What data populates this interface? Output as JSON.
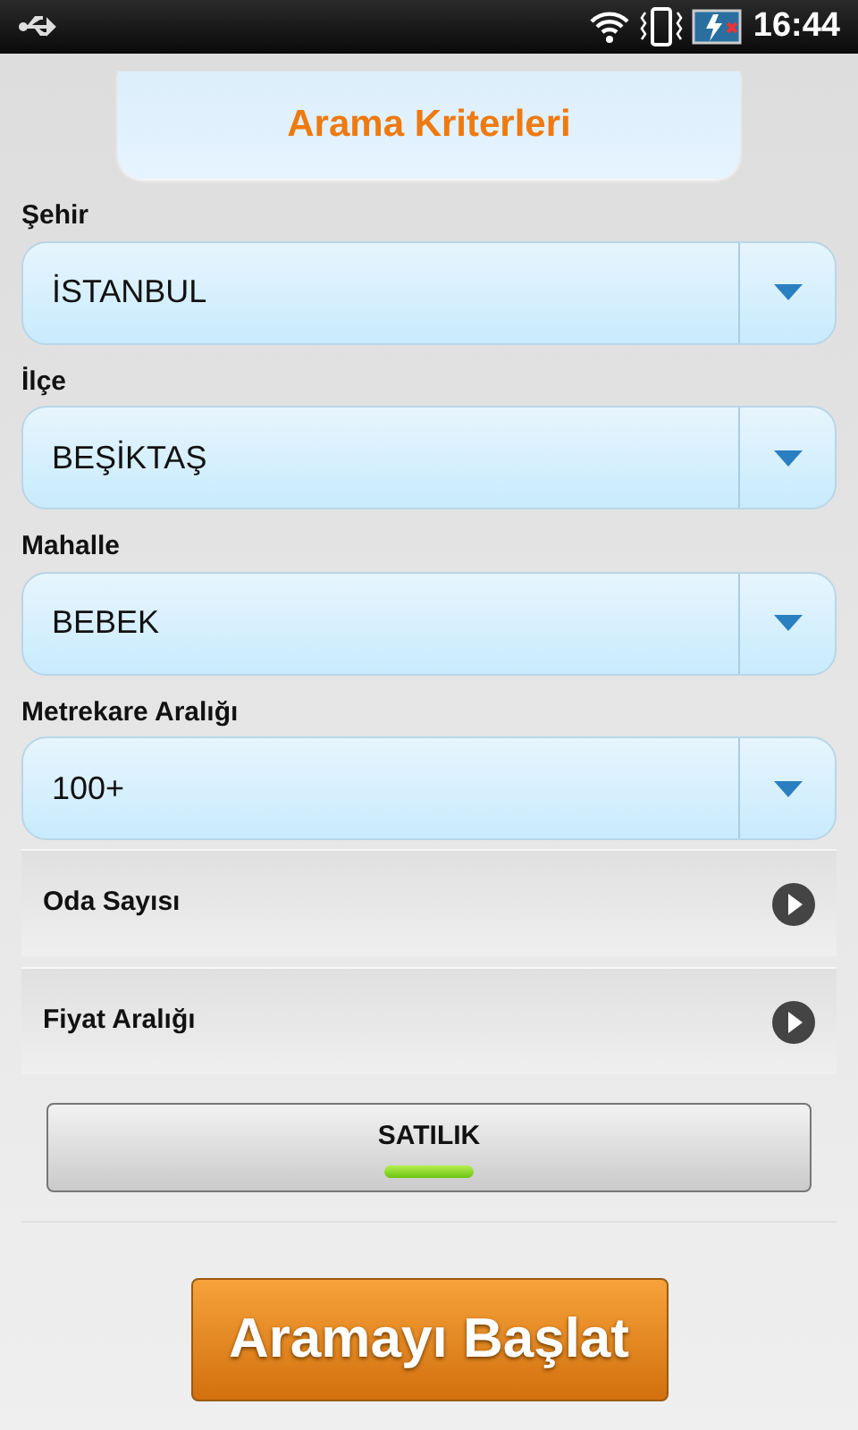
{
  "status_bar": {
    "time": "16:44"
  },
  "header": {
    "title": "Arama Kriterleri"
  },
  "dropdowns": [
    {
      "label": "Şehir",
      "value": "İSTANBUL"
    },
    {
      "label": "İlçe",
      "value": "BEŞİKTAŞ"
    },
    {
      "label": "Mahalle",
      "value": "BEBEK"
    },
    {
      "label": "Metrekare Aralığı",
      "value": "100+"
    }
  ],
  "expand_rows": [
    {
      "label": "Oda Sayısı"
    },
    {
      "label": "Fiyat Aralığı"
    }
  ],
  "toggle": {
    "label": "SATILIK",
    "on": true
  },
  "search_button": {
    "label": "Aramayı Başlat"
  }
}
